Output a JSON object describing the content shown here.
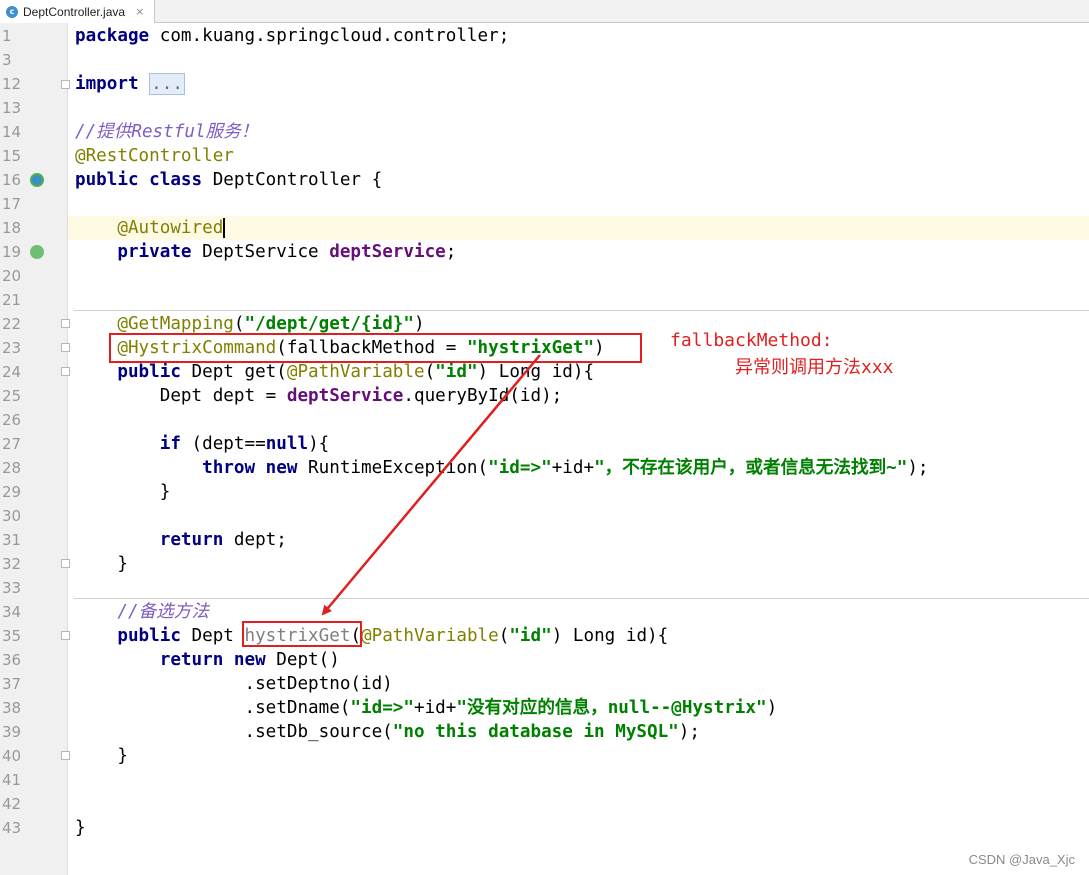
{
  "tab": {
    "label": "DeptController.java",
    "close": "×"
  },
  "lines": {
    "l1": "1",
    "l2": "3",
    "l3": "12",
    "l4": "13",
    "l5": "14",
    "l6": "15",
    "l7": "16",
    "l8": "17",
    "l9": "18",
    "l10": "19",
    "l11": "20",
    "l12": "21",
    "l13": "22",
    "l14": "23",
    "l15": "24",
    "l16": "25",
    "l17": "26",
    "l18": "27",
    "l19": "28",
    "l20": "29",
    "l21": "30",
    "l22": "31",
    "l23": "32",
    "l24": "33",
    "l25": "34",
    "l26": "35",
    "l27": "36",
    "l28": "37",
    "l29": "38",
    "l30": "39",
    "l31": "40",
    "l32": "41",
    "l33": "42",
    "l34": "43"
  },
  "code": {
    "package_kw": "package",
    "package_name": " com.kuang.springcloud.controller;",
    "import_kw": "import",
    "import_fold": "...",
    "comment_restful": "//提供Restful服务！",
    "ann_restcontroller": "@RestController",
    "public_kw": "public",
    "class_kw": "class",
    "class_name": " DeptController {",
    "ann_autowired": "@Autowired",
    "private_kw": "private",
    "dept_service_type": " DeptService ",
    "dept_service_field": "deptService",
    "semicolon": ";",
    "ann_getmapping": "@GetMapping",
    "getmapping_open": "(",
    "getmapping_str": "\"/dept/get/{id}\"",
    "getmapping_close": ")",
    "ann_hystrix": "@HystrixCommand",
    "hystrix_param": "(fallbackMethod = ",
    "hystrix_str": "\"hystrixGet\"",
    "hystrix_close": ")",
    "get_sig_a": " Dept get(",
    "ann_pathvar": "@PathVariable",
    "pv_open": "(",
    "pv_str": "\"id\"",
    "get_sig_b": ") Long id){",
    "dept_decl_a": "Dept dept = ",
    "dept_decl_b": ".queryById(id);",
    "if_kw": "if",
    "if_cond_a": " (dept==",
    "null_kw": "null",
    "if_cond_b": "){",
    "throw_kw": "throw",
    "new_kw": "new",
    "throw_a": " RuntimeException(",
    "throw_str1": "\"id=>\"",
    "throw_plus": "+id+",
    "throw_str2": "\"，不存在该用户，或者信息无法找到~\"",
    "throw_end": ");",
    "brace_close": "}",
    "return_kw": "return",
    "return_dept": " dept;",
    "comment_backup": "//备选方法",
    "backup_sig_a": " Dept ",
    "backup_name": "hystrixGet",
    "backup_sig_b": "(",
    "backup_sig_c": ") Long id){",
    "return_new_b": " Dept()",
    "set_deptno": ".setDeptno(id)",
    "set_dname_a": ".setDname(",
    "set_dname_str1": "\"id=>\"",
    "set_dname_plus": "+id+",
    "set_dname_str2": "\"没有对应的信息，null--@Hystrix\"",
    "set_dname_end": ")",
    "set_db_a": ".setDb_source(",
    "set_db_str": "\"no this database in MySQL\"",
    "set_db_end": ");"
  },
  "annotations": {
    "note_line1": "fallbackMethod:",
    "note_line2": "异常则调用方法xxx"
  },
  "watermark": "CSDN @Java_Xjc",
  "colors": {
    "annotation_red": "#e02020",
    "keyword": "#000080",
    "string": "#008000"
  }
}
